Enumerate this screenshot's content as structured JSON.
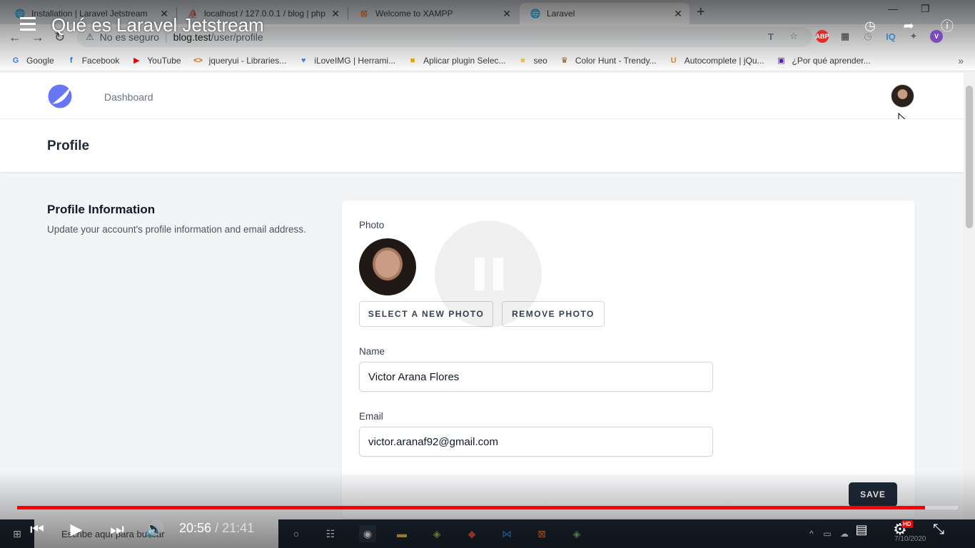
{
  "browser": {
    "tabs": [
      {
        "title": "Installation | Laravel Jetstream",
        "icon": "globe-icon"
      },
      {
        "title": "localhost / 127.0.0.1 / blog | php",
        "icon": "phpmyadmin-icon"
      },
      {
        "title": "Welcome to XAMPP",
        "icon": "xampp-icon"
      },
      {
        "title": "Laravel",
        "icon": "globe-icon"
      }
    ],
    "address": {
      "security_text": "No es seguro",
      "host": "blog.test",
      "path": "/user/profile"
    },
    "bookmarks": [
      {
        "label": "Google",
        "icon": "G",
        "color": "#4285f4"
      },
      {
        "label": "Facebook",
        "icon": "f",
        "color": "#1877f2"
      },
      {
        "label": "YouTube",
        "icon": "▶",
        "color": "#ff0000"
      },
      {
        "label": "jqueryui - Libraries...",
        "icon": "<>",
        "color": "#e8710a"
      },
      {
        "label": "iLoveIMG | Herrami...",
        "icon": "♥",
        "color": "#4a90e2"
      },
      {
        "label": "Aplicar plugin Selec...",
        "icon": "■",
        "color": "#f4b400"
      },
      {
        "label": "seo",
        "icon": "■",
        "color": "#f6d36b"
      },
      {
        "label": "Color Hunt - Trendy...",
        "icon": "♛",
        "color": "#8a5a2b"
      },
      {
        "label": "Autocomplete | jQu...",
        "icon": "U",
        "color": "#f29111"
      },
      {
        "label": "¿Por qué aprender...",
        "icon": "▣",
        "color": "#5b2bab"
      }
    ],
    "extensions": [
      {
        "name": "translate-icon",
        "label": "T",
        "color": "#5f6368"
      },
      {
        "name": "star-icon",
        "label": "☆",
        "color": "#5f6368"
      },
      {
        "name": "adblock-icon",
        "label": "ABP",
        "color": "#e22b2b"
      },
      {
        "name": "qr-icon",
        "label": "▦",
        "color": "#333333"
      },
      {
        "name": "timer-extension-icon",
        "label": "◷",
        "color": "#888888"
      },
      {
        "name": "iq-extension-icon",
        "label": "IQ",
        "color": "#3a86c8"
      },
      {
        "name": "puzzle-icon",
        "label": "✦",
        "color": "#5f6368"
      },
      {
        "name": "profile-icon",
        "label": "V",
        "color": "#7b4bb7"
      }
    ]
  },
  "app": {
    "nav": {
      "dashboard_label": "Dashboard"
    },
    "header_title": "Profile",
    "section": {
      "title": "Profile Information",
      "description": "Update your account's profile information and email address."
    },
    "form": {
      "photo_label": "Photo",
      "select_photo_label": "SELECT A NEW PHOTO",
      "remove_photo_label": "REMOVE PHOTO",
      "name_label": "Name",
      "name_value": "Victor Arana Flores",
      "email_label": "Email",
      "email_value": "victor.aranaf92@gmail.com",
      "save_label": "SAVE"
    },
    "logo_color": "#6875f5"
  },
  "video": {
    "title": "Qué es Laravel Jetstream",
    "current_time": "20:56",
    "duration": "21:41",
    "progress_fraction": 0.965
  },
  "taskbar": {
    "search_placeholder": "Escribe aquí para buscar",
    "date": "7/10/2020",
    "hd_label": "HD"
  }
}
